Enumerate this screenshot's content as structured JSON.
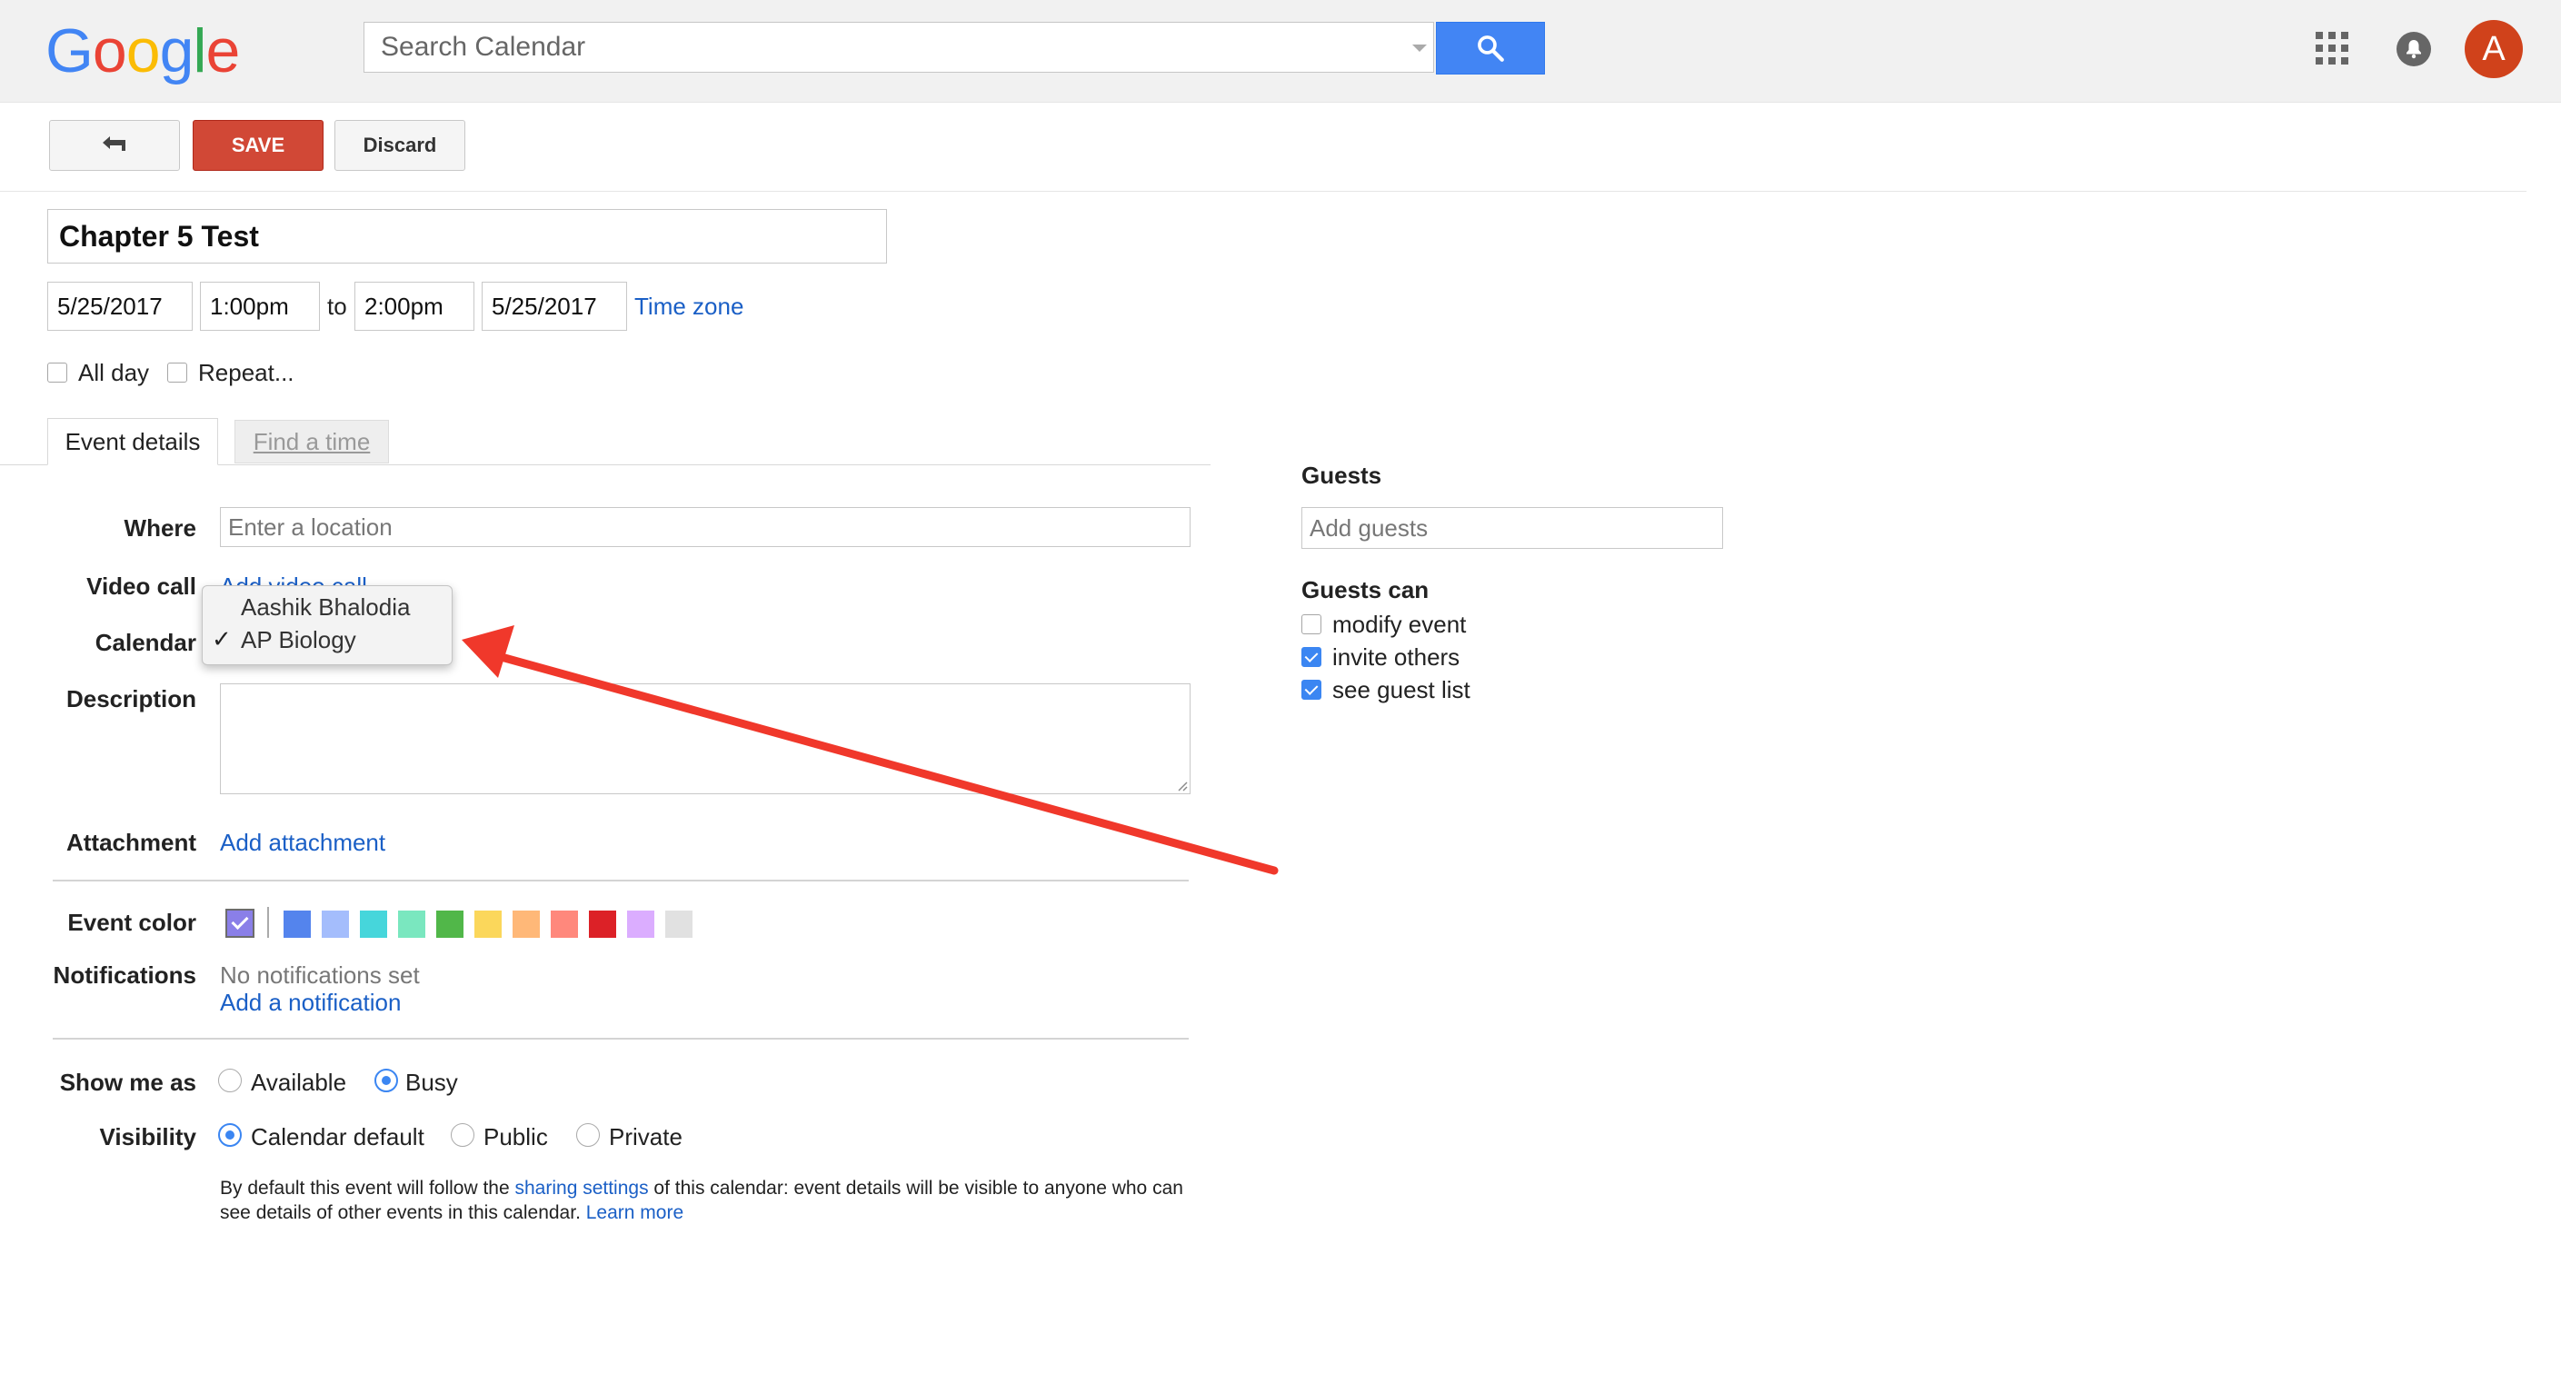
{
  "header": {
    "logo": [
      "G",
      "o",
      "o",
      "g",
      "l",
      "e"
    ],
    "logo_colors": [
      "#4285f4",
      "#ea4335",
      "#fbbc05",
      "#4285f4",
      "#34a853",
      "#ea4335"
    ],
    "search_placeholder": "Search Calendar",
    "search_button_icon": "search-icon",
    "apps_icon": "apps-grid-icon",
    "notifications_icon": "notifications-bell-icon",
    "avatar_letter": "A",
    "avatar_color": "#d0421b"
  },
  "toolbar": {
    "back_icon": "back-arrow-icon",
    "save_label": "SAVE",
    "discard_label": "Discard",
    "save_color": "#d14836"
  },
  "event": {
    "title": "Chapter 5 Test",
    "start_date": "5/25/2017",
    "start_time": "1:00pm",
    "to_label": "to",
    "end_time": "2:00pm",
    "end_date": "5/25/2017",
    "time_zone_label": "Time zone",
    "all_day_label": "All day",
    "repeat_label": "Repeat...",
    "all_day_checked": false,
    "repeat_checked": false
  },
  "tabs": {
    "event_details": "Event details",
    "find_a_time": "Find a time"
  },
  "form": {
    "where_label": "Where",
    "where_placeholder": "Enter a location",
    "video_label": "Video call",
    "video_link": "Add video call",
    "calendar_label": "Calendar",
    "description_label": "Description",
    "attachment_label": "Attachment",
    "attachment_link": "Add attachment",
    "event_color_label": "Event color",
    "selected_color": "#8a7fe8",
    "color_swatches": [
      "#5484ed",
      "#a4bdfc",
      "#46d6db",
      "#7ae7bf",
      "#51b749",
      "#fbd75b",
      "#ffb878",
      "#ff887c",
      "#dc2127",
      "#dbadff",
      "#e1e1e1"
    ],
    "notifications_label": "Notifications",
    "no_notifications": "No notifications set",
    "add_notification": "Add a notification",
    "show_me_as_label": "Show me as",
    "available_label": "Available",
    "busy_label": "Busy",
    "show_me_as_selected": "Busy",
    "visibility_label": "Visibility",
    "calendar_default_label": "Calendar default",
    "public_label": "Public",
    "private_label": "Private",
    "visibility_selected": "Calendar default",
    "note_part1": "By default this event will follow the ",
    "note_link1": "sharing settings",
    "note_part2": " of this calendar: event details will be visible to anyone who can see details of other events in this calendar.  ",
    "note_link2": "Learn more"
  },
  "calendar_menu": {
    "items": [
      "Aashik Bhalodia",
      "AP Biology"
    ],
    "selected": "AP Biology",
    "check_mark": "✓"
  },
  "guests": {
    "title": "Guests",
    "add_placeholder": "Add guests",
    "guests_can_label": "Guests can",
    "permissions": [
      {
        "label": "modify event",
        "checked": false
      },
      {
        "label": "invite others",
        "checked": true
      },
      {
        "label": "see guest list",
        "checked": true
      }
    ]
  },
  "annotation": {
    "arrow_color": "#f0382b"
  }
}
